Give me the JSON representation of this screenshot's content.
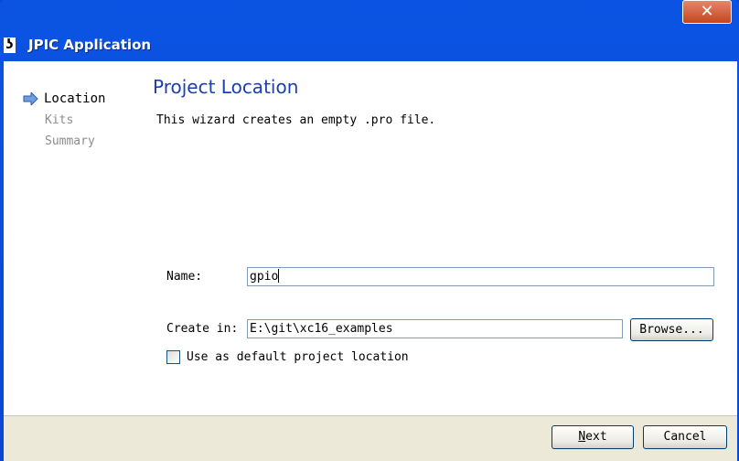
{
  "window": {
    "title": "JPIC Application",
    "icon": "app-icon",
    "close_label": "✕"
  },
  "steps": [
    {
      "label": "Location",
      "state": "current"
    },
    {
      "label": "Kits",
      "state": "pending"
    },
    {
      "label": "Summary",
      "state": "pending"
    }
  ],
  "page": {
    "title": "Project Location",
    "description": "This wizard creates an empty .pro file."
  },
  "form": {
    "name_label": "Name:",
    "name_value": "gpio",
    "create_in_label": "Create in:",
    "create_in_value": "E:\\git\\xc16_examples",
    "browse_label": "Browse...",
    "default_location_label": "Use as default project location",
    "default_location_checked": false
  },
  "buttons": {
    "next_label": "Next",
    "cancel_label": "Cancel"
  },
  "colors": {
    "titlebar": "#0a4ad8",
    "page_title": "#1c3fb0",
    "inactive_step": "#8c8c8c"
  }
}
